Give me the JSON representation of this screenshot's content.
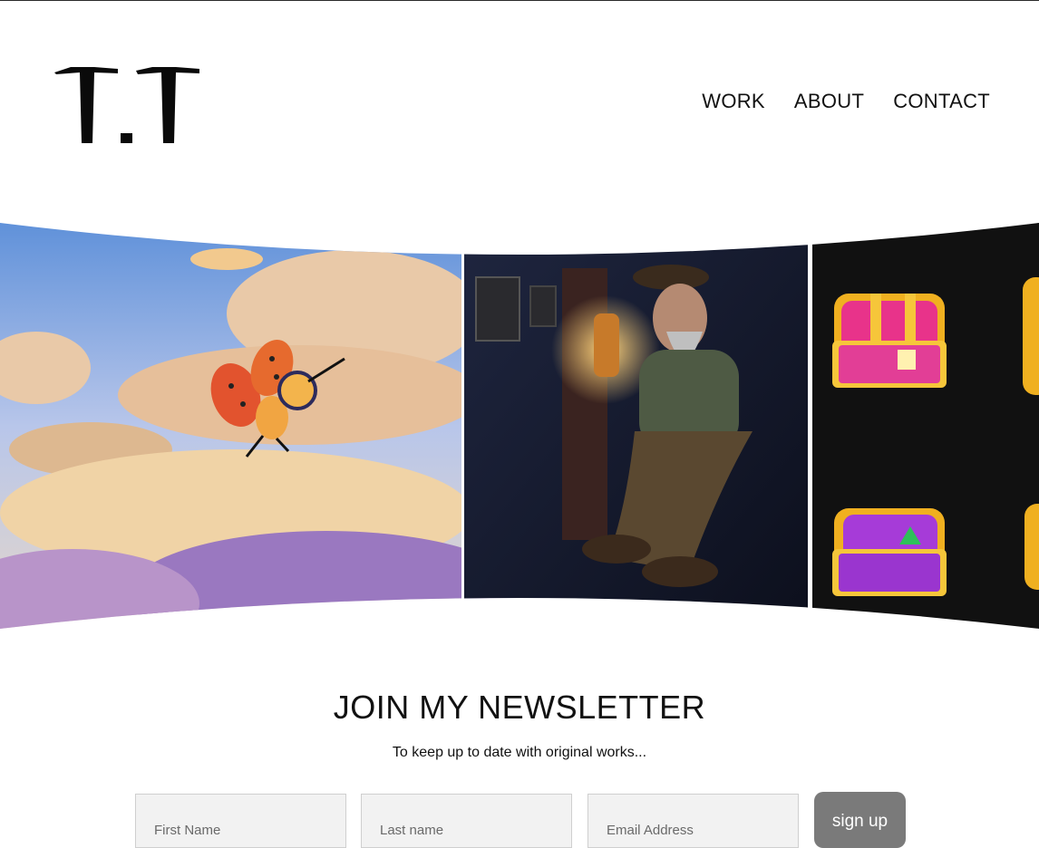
{
  "header": {
    "logo_text": "T.T",
    "nav": [
      "WORK",
      "ABOUT",
      "CONTACT"
    ]
  },
  "gallery": {
    "artworks": [
      {
        "name": "ladybug-flying-clouds"
      },
      {
        "name": "old-man-with-lantern"
      },
      {
        "name": "treasure-chests"
      }
    ]
  },
  "newsletter": {
    "title": "JOIN MY NEWSLETTER",
    "subtitle": "To keep up to date with original works...",
    "first_name_placeholder": "First Name",
    "last_name_placeholder": "Last name",
    "email_placeholder": "Email Address",
    "button_label": "sign up"
  }
}
